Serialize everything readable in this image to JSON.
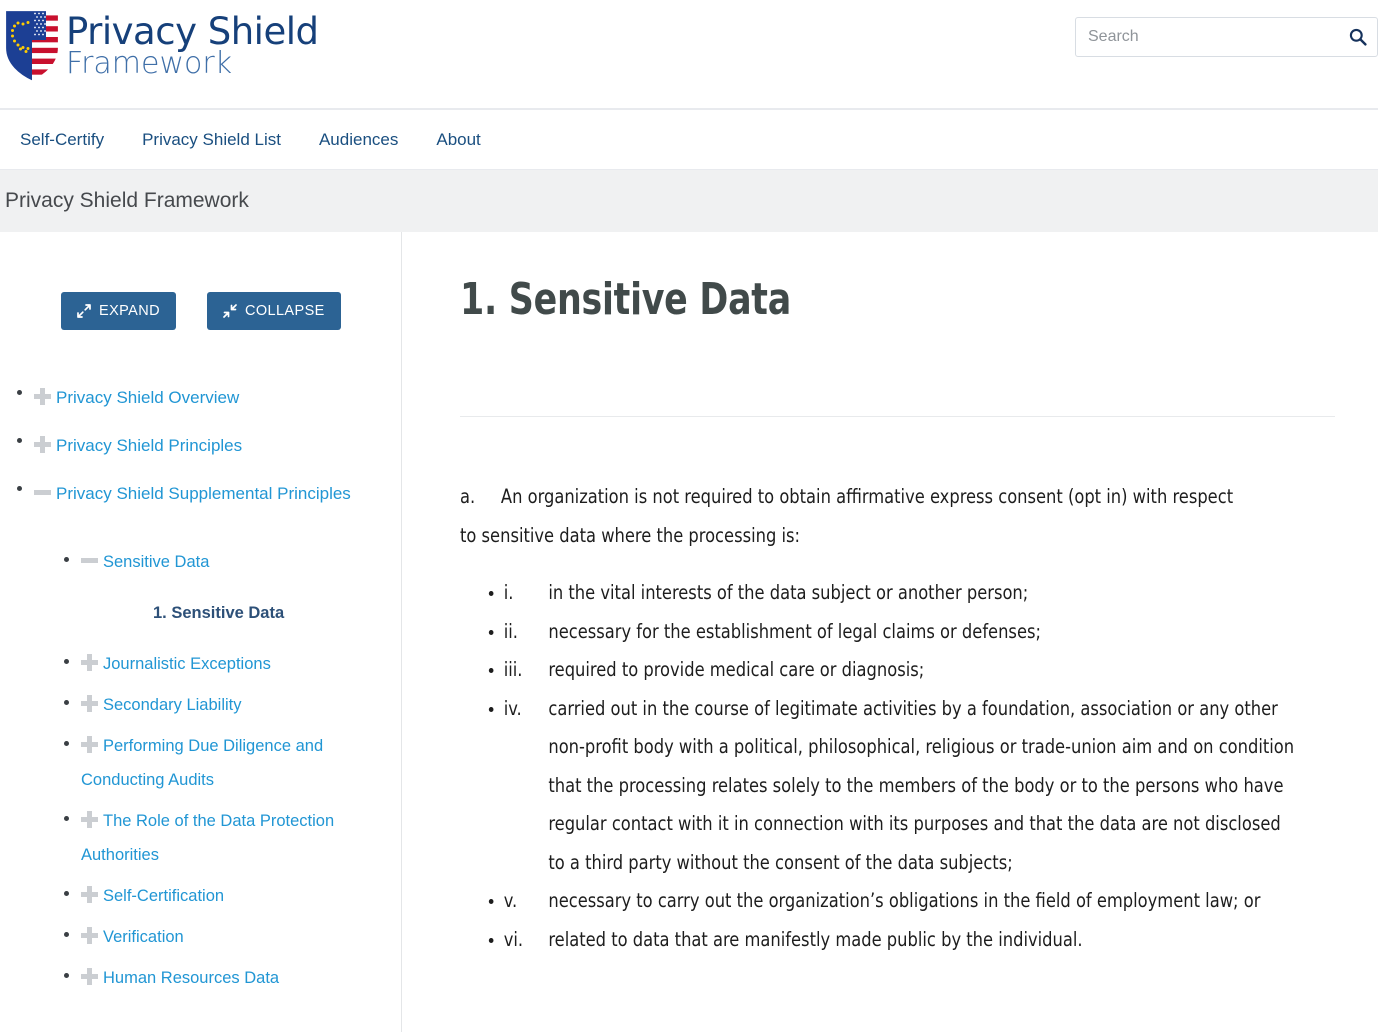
{
  "header": {
    "brand_line1": "Privacy Shield",
    "brand_line2": "Framework",
    "logo_icon": "eu-us-shield-icon",
    "search": {
      "placeholder": "Search",
      "value": "",
      "icon": "search-icon"
    }
  },
  "nav": {
    "items": [
      {
        "label": "Self-Certify"
      },
      {
        "label": "Privacy Shield List"
      },
      {
        "label": "Audiences"
      },
      {
        "label": "About"
      }
    ]
  },
  "breadcrumb": {
    "title": "Privacy Shield Framework"
  },
  "sidebar": {
    "expand_label": "EXPAND",
    "collapse_label": "COLLAPSE",
    "expand_icon": "expand-arrows-icon",
    "collapse_icon": "collapse-arrows-icon",
    "tree": [
      {
        "label": "Privacy Shield Overview",
        "state": "collapsed",
        "icon": "plus-icon"
      },
      {
        "label": "Privacy Shield Principles",
        "state": "collapsed",
        "icon": "plus-icon"
      },
      {
        "label": "Privacy Shield Supplemental Principles",
        "state": "expanded",
        "icon": "minus-icon"
      }
    ],
    "subtree": [
      {
        "label": "Sensitive Data",
        "state": "expanded",
        "icon": "minus-icon"
      },
      {
        "label": "Journalistic Exceptions",
        "state": "collapsed",
        "icon": "plus-icon"
      },
      {
        "label": "Secondary Liability",
        "state": "collapsed",
        "icon": "plus-icon"
      },
      {
        "label": "Performing Due Diligence and Conducting Audits",
        "state": "collapsed",
        "icon": "plus-icon"
      },
      {
        "label": "The Role of the Data Protection Authorities",
        "state": "collapsed",
        "icon": "plus-icon"
      },
      {
        "label": "Self-Certification",
        "state": "collapsed",
        "icon": "plus-icon"
      },
      {
        "label": "Verification",
        "state": "collapsed",
        "icon": "plus-icon"
      },
      {
        "label": "Human Resources Data",
        "state": "collapsed",
        "icon": "plus-icon"
      }
    ],
    "active_page": "1. Sensitive Data"
  },
  "main": {
    "title": "1. Sensitive Data",
    "paragraph": {
      "marker": "a.",
      "text": "An organization is not required to obtain affirmative express consent (opt in) with respect to sensitive data where the processing is:"
    },
    "list": [
      {
        "marker": "i.",
        "text": "in the vital interests of the data subject or another person;"
      },
      {
        "marker": "ii.",
        "text": "necessary for the establishment of legal claims or defenses;"
      },
      {
        "marker": "iii.",
        "text": "required to provide medical care or diagnosis;"
      },
      {
        "marker": "iv.",
        "text": "carried out in the course of legitimate activities by a foundation, association or any other non-profit body with a political, philosophical, religious or trade-union aim and on condition that the processing relates solely to the members of the body or to the persons who have regular contact with it in connection with its purposes and that the data are not disclosed to a third party without the consent of the data subjects;"
      },
      {
        "marker": "v.",
        "text": "necessary to carry out the organization’s obligations in the field of employment law; or"
      },
      {
        "marker": "vi.",
        "text": "related to data that are manifestly made public by the individual."
      }
    ]
  },
  "colors": {
    "brand_navy": "#16407a",
    "link_blue": "#2196d4",
    "button_blue": "#2c6394",
    "nav_link": "#1a4f80",
    "crumb_bg": "#f0f1f2",
    "heading_gray": "#414a4a",
    "icon_gray": "#cbced2"
  }
}
